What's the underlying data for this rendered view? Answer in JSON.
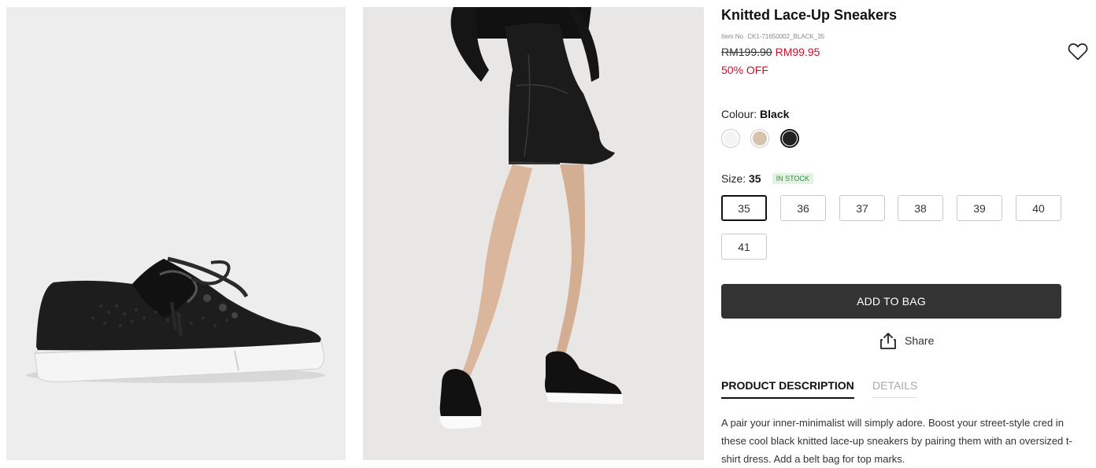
{
  "product": {
    "title": "Knitted Lace-Up Sneakers",
    "item_no_label": "Item No.",
    "item_no": "CK1-71650002_BLACK_35",
    "price_original": "RM199.90",
    "price_sale": "RM99.95",
    "discount": "50% OFF"
  },
  "colour": {
    "label": "Colour:",
    "selected": "Black",
    "options": [
      "white",
      "beige",
      "black"
    ]
  },
  "size": {
    "label": "Size:",
    "selected": "35",
    "stock_badge": "IN STOCK",
    "options": [
      "35",
      "36",
      "37",
      "38",
      "39",
      "40",
      "41"
    ]
  },
  "actions": {
    "add_to_bag": "ADD TO BAG",
    "share": "Share"
  },
  "tabs": {
    "description": "PRODUCT DESCRIPTION",
    "details": "DETAILS"
  },
  "description": "A pair your inner-minimalist will simply adore. Boost your street-style cred in these cool black knitted lace-up sneakers by pairing them with an oversized t-shirt dress. Add a belt bag for top marks.",
  "icons": {
    "wishlist": "heart-icon",
    "share": "share-icon"
  },
  "colors": {
    "accent": "#333333",
    "sale": "#c8102e",
    "stock": "#2e8b3c"
  }
}
